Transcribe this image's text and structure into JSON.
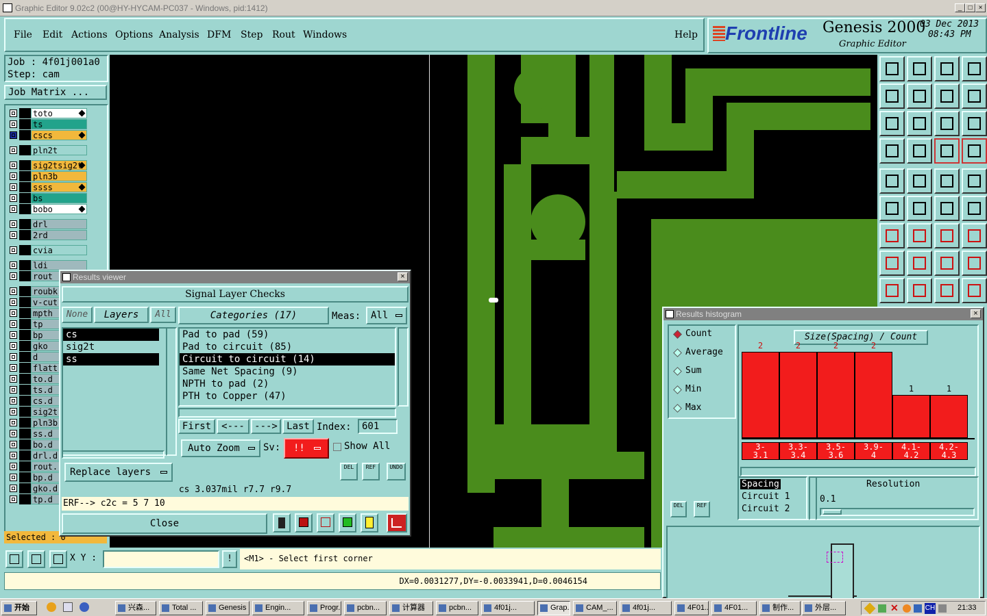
{
  "window": {
    "title": "Graphic Editor 9.02c2 (00@HY-HYCAM-PC037 - Windows, pid:1412)"
  },
  "menu": [
    "File",
    "Edit",
    "Actions",
    "Options",
    "Analysis",
    "DFM",
    "Step",
    "Rout",
    "Windows"
  ],
  "help": "Help",
  "brand": {
    "logo": "Frontline",
    "product": "Genesis 2000",
    "subtitle": "Graphic Editor",
    "date": "03 Dec 2013",
    "time": "08:43 PM"
  },
  "job": {
    "job": "Job : 4f01j001a0",
    "step": "Step: cam",
    "matrix": "Job Matrix ..."
  },
  "layers": [
    {
      "name": "to",
      "color": "#ffffff",
      "icon": "pen-icon"
    },
    {
      "name": "ts",
      "color": "#22a38b"
    },
    {
      "name": "cs",
      "color": "#f2b83c",
      "icon": "pen-icon",
      "active": true
    },
    {
      "name": "pln2t",
      "color": "#9ed6d0"
    },
    {
      "name": "sig2t",
      "color": "#f2b83c",
      "icon": "pen-icon"
    },
    {
      "name": "pln3b",
      "color": "#f2b83c"
    },
    {
      "name": "ss",
      "color": "#f2b83c",
      "icon": "pen-icon"
    },
    {
      "name": "bs",
      "color": "#22a38b"
    },
    {
      "name": "bo",
      "color": "#ffffff",
      "icon": "pen-icon"
    },
    {
      "name": "drl",
      "color": "#9fb9bd"
    },
    {
      "name": "2rd",
      "color": "#9fb9bd"
    },
    {
      "name": "cvia",
      "color": "#9ed6d0"
    },
    {
      "name": "ldi",
      "color": "#9fb9bd"
    },
    {
      "name": "rout",
      "color": "#9fb9bd"
    },
    {
      "name": "roubk",
      "color": "#9fb9bd"
    },
    {
      "name": "v-cut",
      "color": "#9fb9bd"
    },
    {
      "name": "mpth",
      "color": "#9fb9bd"
    },
    {
      "name": "tp",
      "color": "#9fb9bd"
    },
    {
      "name": "bp",
      "color": "#9fb9bd"
    },
    {
      "name": "gko",
      "color": "#9fb9bd"
    },
    {
      "name": "d",
      "color": "#9fb9bd"
    },
    {
      "name": "flatt",
      "color": "#9fb9bd"
    },
    {
      "name": "to.d",
      "color": "#9fb9bd"
    },
    {
      "name": "ts.d",
      "color": "#9fb9bd"
    },
    {
      "name": "cs.d",
      "color": "#9fb9bd"
    },
    {
      "name": "sig2t",
      "color": "#9fb9bd"
    },
    {
      "name": "pln3b",
      "color": "#9fb9bd"
    },
    {
      "name": "ss.d",
      "color": "#9fb9bd"
    },
    {
      "name": "bo.d",
      "color": "#9fb9bd"
    },
    {
      "name": "drl.d",
      "color": "#9fb9bd"
    },
    {
      "name": "rout.",
      "color": "#9fb9bd"
    },
    {
      "name": "bp.d",
      "color": "#9fb9bd"
    },
    {
      "name": "gko.d",
      "color": "#9fb9bd"
    },
    {
      "name": "tp.d",
      "color": "#9fb9bd"
    }
  ],
  "selected": "Selected : 0",
  "results_viewer": {
    "title": "Results viewer",
    "header": "Signal Layer Checks",
    "none": "None",
    "layers_btn": "Layers",
    "all_btn": "All",
    "layer_list": [
      {
        "name": "cs",
        "sel": true
      },
      {
        "name": "sig2t",
        "sel": false
      },
      {
        "name": "ss",
        "sel": true
      }
    ],
    "categories_btn": "Categories (17)",
    "meas_label": "Meas:",
    "meas_value": "All",
    "categories": [
      {
        "name": "Pad to pad (59)",
        "sel": false
      },
      {
        "name": "Pad to circuit (85)",
        "sel": false
      },
      {
        "name": "Circuit to circuit (14)",
        "sel": true
      },
      {
        "name": "Same Net Spacing (9)",
        "sel": false
      },
      {
        "name": "NPTH to pad (2)",
        "sel": false
      },
      {
        "name": "PTH to Copper (47)",
        "sel": false
      }
    ],
    "first": "First",
    "prev": "<---",
    "next": "--->",
    "last": "Last",
    "index_label": "Index:",
    "index_value": "601",
    "auto_zoom": "Auto Zoom",
    "sv_label": "Sv:",
    "sv_value": "!!",
    "show_all": "Show All",
    "replace_layers": "Replace layers",
    "del": "DEL",
    "ref": "REF",
    "undo": "UNDO",
    "status": "cs 3.037mil   r7.7   r9.7",
    "erf": "ERF--> c2c = 5 7 10",
    "close": "Close"
  },
  "histogram": {
    "title": "Results histogram",
    "options": [
      "Count",
      "Average",
      "Sum",
      "Min",
      "Max"
    ],
    "selected_option": "Count",
    "header": "Size(Spacing) / Count",
    "bins": [
      {
        "label_top": "3-",
        "label_bot": "3.1",
        "count": 2
      },
      {
        "label_top": "3.3-",
        "label_bot": "3.4",
        "count": 2
      },
      {
        "label_top": "3.5-",
        "label_bot": "3.6",
        "count": 2
      },
      {
        "label_top": "3.9-",
        "label_bot": "4",
        "count": 2
      },
      {
        "label_top": "4.1-",
        "label_bot": "4.2",
        "count": 1
      },
      {
        "label_top": "4.2-",
        "label_bot": "4.3",
        "count": 1
      }
    ],
    "info": [
      "Spacing",
      "Circuit 1",
      "Circuit 2"
    ],
    "resolution_label": "Resolution",
    "resolution_value": "0.1",
    "del": "DEL",
    "ref": "REF"
  },
  "bottom": {
    "xy_label": "X Y :",
    "prompt": "<M1> - Select first corner",
    "coords": "DX=0.0031277,DY=-0.0033941,D=0.0046154"
  },
  "taskbar": {
    "start": "开始",
    "items": [
      "兴森...",
      "Total ...",
      "Genesis",
      "Engin...",
      "Progr...",
      "pcbn...",
      "计算器",
      "pcbn...",
      "4f01j...",
      "Grap...",
      "CAM_...",
      "4f01j...",
      "4F01...",
      "4F01...",
      "制作...",
      "外层..."
    ],
    "active_index": 9,
    "clock": "21:33",
    "ime": "CH"
  }
}
